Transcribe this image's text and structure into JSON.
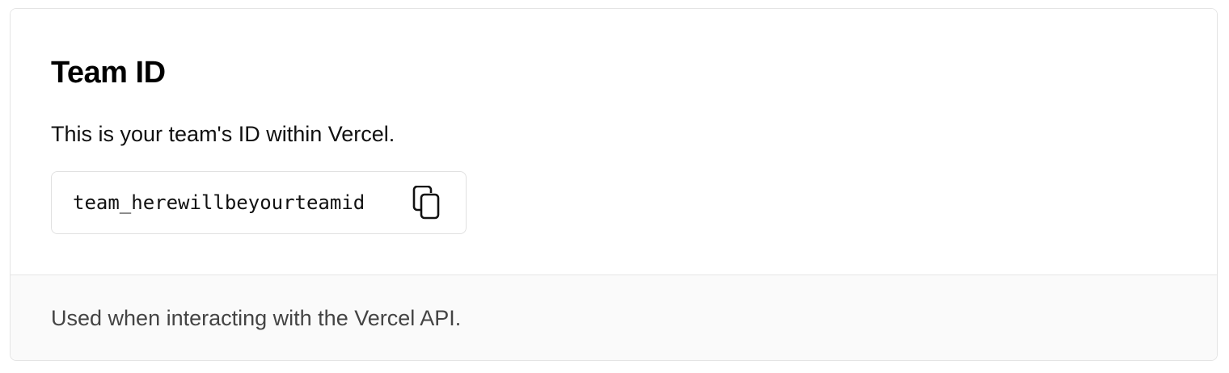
{
  "team_id_card": {
    "title": "Team ID",
    "description": "This is your team's ID within Vercel.",
    "team_id_value": "team_herewillbeyourteamid",
    "copy_icon": "copy-icon",
    "footer_note": "Used when interacting with the Vercel API."
  },
  "colors": {
    "title": "#000000",
    "body_text": "#111111",
    "footer_text": "#444444",
    "footer_background": "#fafafa",
    "border": "#e4e4e4"
  }
}
